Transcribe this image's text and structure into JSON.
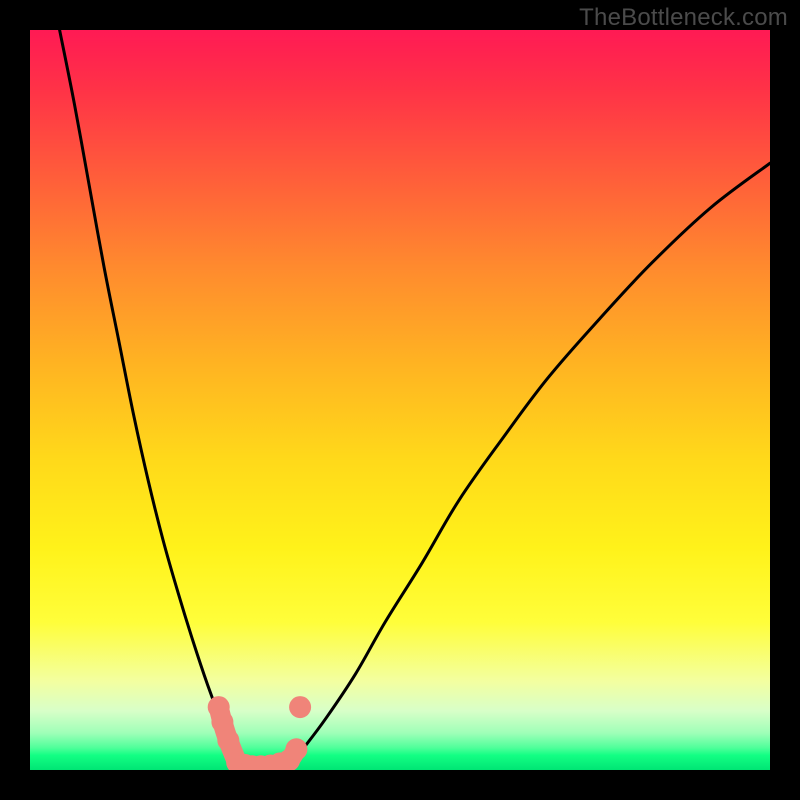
{
  "watermark": "TheBottleneck.com",
  "chart_data": {
    "type": "line",
    "title": "",
    "xlabel": "",
    "ylabel": "",
    "xlim": [
      0,
      100
    ],
    "ylim": [
      0,
      100
    ],
    "series": [
      {
        "name": "left-curve",
        "x": [
          4,
          6,
          8,
          10,
          12,
          14,
          16,
          18,
          20,
          22,
          24,
          25.5,
          27,
          28,
          29
        ],
        "y": [
          100,
          90,
          79,
          68,
          58,
          48,
          39,
          31,
          24,
          17.5,
          11.5,
          7.5,
          4,
          2,
          0.5
        ]
      },
      {
        "name": "right-curve",
        "x": [
          35,
          37,
          40,
          44,
          48,
          53,
          58,
          64,
          70,
          77,
          84,
          92,
          100
        ],
        "y": [
          0.5,
          3,
          7,
          13,
          20,
          28,
          36.5,
          45,
          53,
          61,
          68.5,
          76,
          82
        ]
      },
      {
        "name": "pink-dots-left",
        "x": [
          25.5,
          26,
          26.8,
          28
        ],
        "y": [
          8.5,
          6.5,
          4,
          1
        ]
      },
      {
        "name": "pink-dots-valley",
        "x": [
          29,
          30,
          31.2,
          32.5,
          33.8,
          35,
          36
        ],
        "y": [
          0.7,
          0.5,
          0.5,
          0.6,
          0.9,
          1.3,
          2.8
        ]
      },
      {
        "name": "pink-dot-right",
        "x": [
          36.5
        ],
        "y": [
          8.5
        ]
      }
    ],
    "colors": {
      "curve": "#000000",
      "dots": "#f08479"
    }
  }
}
